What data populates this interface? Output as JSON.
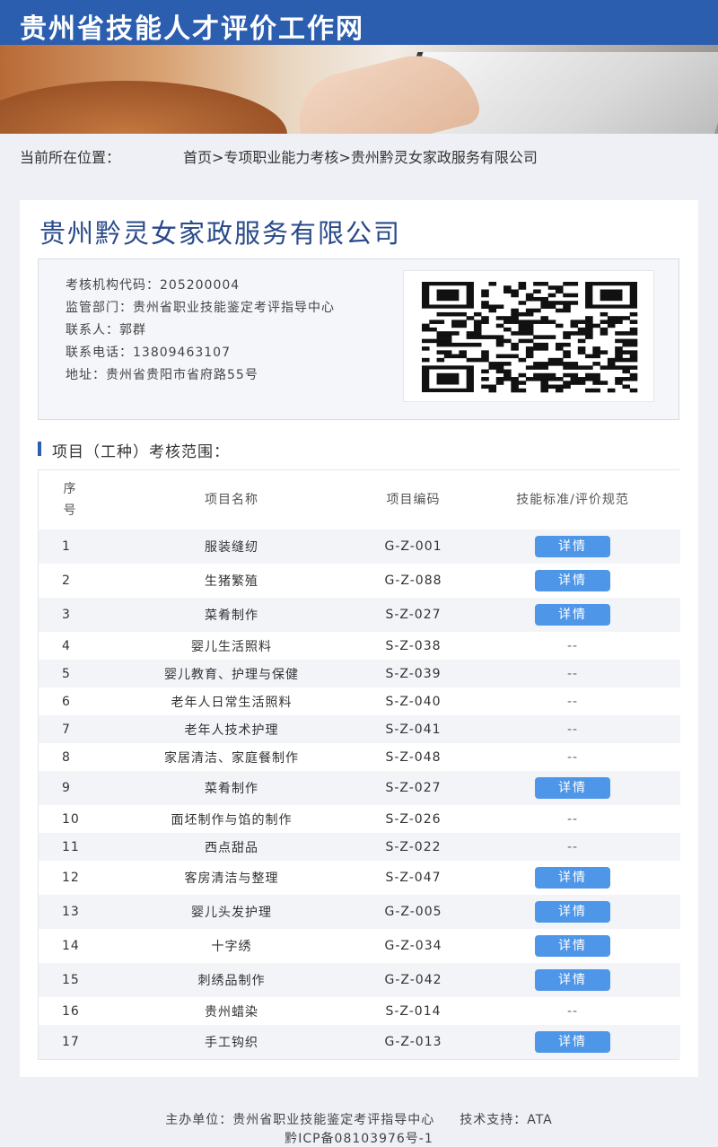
{
  "header": {
    "site_title": "贵州省技能人才评价工作网"
  },
  "breadcrumb": {
    "label": "当前所在位置：",
    "items": [
      "首页",
      "专项职业能力考核",
      "贵州黔灵女家政服务有限公司"
    ],
    "separator": ">"
  },
  "company": {
    "name": "贵州黔灵女家政服务有限公司",
    "info": {
      "org_code_label": "考核机构代码：",
      "org_code": "205200004",
      "department_label": "监管部门：",
      "department": "贵州省职业技能鉴定考评指导中心",
      "contact_label": "联系人：",
      "contact": "郭群",
      "phone_label": "联系电话：",
      "phone": "13809463107",
      "address_label": "地址：",
      "address": "贵州省贵阳市省府路55号"
    }
  },
  "scope": {
    "title": "项目（工种）考核范围：",
    "columns": [
      "序号",
      "项目名称",
      "项目编码",
      "技能标准/评价规范"
    ],
    "detail_label": "详情",
    "empty_label": "--",
    "rows": [
      {
        "seq": "1",
        "name": "服装缝纫",
        "code": "G-Z-001",
        "has_detail": true
      },
      {
        "seq": "2",
        "name": "生猪繁殖",
        "code": "G-Z-088",
        "has_detail": true
      },
      {
        "seq": "3",
        "name": "菜肴制作",
        "code": "S-Z-027",
        "has_detail": true
      },
      {
        "seq": "4",
        "name": "婴儿生活照料",
        "code": "S-Z-038",
        "has_detail": false
      },
      {
        "seq": "5",
        "name": "婴儿教育、护理与保健",
        "code": "S-Z-039",
        "has_detail": false
      },
      {
        "seq": "6",
        "name": "老年人日常生活照料",
        "code": "S-Z-040",
        "has_detail": false
      },
      {
        "seq": "7",
        "name": "老年人技术护理",
        "code": "S-Z-041",
        "has_detail": false
      },
      {
        "seq": "8",
        "name": "家居清洁、家庭餐制作",
        "code": "S-Z-048",
        "has_detail": false
      },
      {
        "seq": "9",
        "name": "菜肴制作",
        "code": "S-Z-027",
        "has_detail": true
      },
      {
        "seq": "10",
        "name": "面坯制作与馅的制作",
        "code": "S-Z-026",
        "has_detail": false
      },
      {
        "seq": "11",
        "name": "西点甜品",
        "code": "S-Z-022",
        "has_detail": false
      },
      {
        "seq": "12",
        "name": "客房清洁与整理",
        "code": "S-Z-047",
        "has_detail": true
      },
      {
        "seq": "13",
        "name": "婴儿头发护理",
        "code": "G-Z-005",
        "has_detail": true
      },
      {
        "seq": "14",
        "name": "十字绣",
        "code": "G-Z-034",
        "has_detail": true
      },
      {
        "seq": "15",
        "name": "刺绣品制作",
        "code": "G-Z-042",
        "has_detail": true
      },
      {
        "seq": "16",
        "name": "贵州蜡染",
        "code": "S-Z-014",
        "has_detail": false
      },
      {
        "seq": "17",
        "name": "手工钩织",
        "code": "G-Z-013",
        "has_detail": true
      }
    ]
  },
  "footer": {
    "host_label": "主办单位：",
    "host": "贵州省职业技能鉴定考评指导中心",
    "support_label": "技术支持：",
    "support": "ATA",
    "icp": "黔ICP备08103976号-1"
  },
  "colors": {
    "header_blue": "#2c5eb0",
    "title_blue": "#2a4a8a",
    "button_blue": "#4e96e8"
  }
}
